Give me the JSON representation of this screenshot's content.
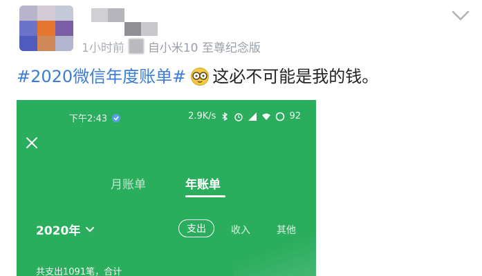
{
  "post": {
    "meta_time": "1小时前",
    "meta_device": "自小米10 至尊纪念版",
    "hashtag": "#2020微信年度账单#",
    "text": "这必不可能是我的钱。"
  },
  "screenshot": {
    "status_time": "下午2:43",
    "status_speed": "2.9K/s",
    "status_battery": "92",
    "tabs": {
      "month": "月账单",
      "year": "年账单"
    },
    "year_select": "2020年",
    "filters": {
      "out": "支出",
      "in": "收入",
      "other": "其他"
    },
    "summary": "共支出1091笔，合计"
  },
  "colors": {
    "wechat_green": "#2bad5e",
    "hashtag_blue": "#3b7dd8"
  },
  "icons": {
    "emoji": "face-with-glasses",
    "chevron": "chevron-down-icon"
  }
}
